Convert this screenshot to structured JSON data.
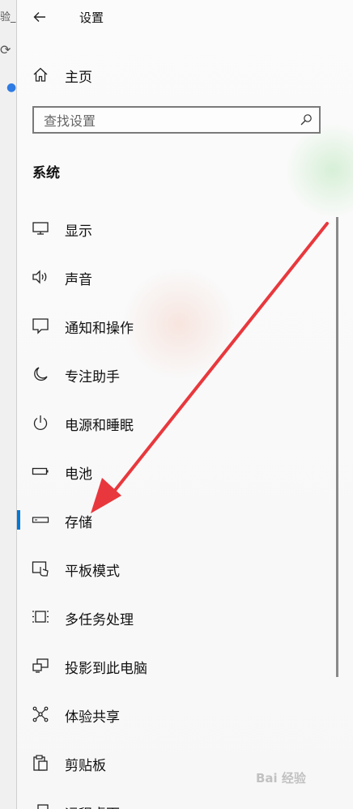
{
  "background_app": {
    "tab_text": "验_",
    "reload_icon": "refresh-icon",
    "logo_icon": "paw-icon"
  },
  "window": {
    "back_icon": "back-arrow-icon",
    "title": "设置"
  },
  "home": {
    "icon": "home-icon",
    "label": "主页"
  },
  "search": {
    "placeholder": "查找设置",
    "icon": "search-icon"
  },
  "section": {
    "title": "系统"
  },
  "nav_items": [
    {
      "label": "显示",
      "icon": "display-icon",
      "selected": false
    },
    {
      "label": "声音",
      "icon": "speaker-icon",
      "selected": false
    },
    {
      "label": "通知和操作",
      "icon": "notification-icon",
      "selected": false
    },
    {
      "label": "专注助手",
      "icon": "moon-icon",
      "selected": false
    },
    {
      "label": "电源和睡眠",
      "icon": "power-icon",
      "selected": false
    },
    {
      "label": "电池",
      "icon": "battery-icon",
      "selected": false
    },
    {
      "label": "存储",
      "icon": "storage-icon",
      "selected": true
    },
    {
      "label": "平板模式",
      "icon": "tablet-mode-icon",
      "selected": false
    },
    {
      "label": "多任务处理",
      "icon": "multitasking-icon",
      "selected": false
    },
    {
      "label": "投影到此电脑",
      "icon": "project-icon",
      "selected": false
    },
    {
      "label": "体验共享",
      "icon": "share-icon",
      "selected": false
    },
    {
      "label": "剪贴板",
      "icon": "clipboard-icon",
      "selected": false
    },
    {
      "label": "远程桌面",
      "icon": "remote-desktop-icon",
      "selected": false
    }
  ],
  "colors": {
    "accent": "#0078d7",
    "annotation_arrow": "#e8383d"
  },
  "watermark": "Bai 经验"
}
